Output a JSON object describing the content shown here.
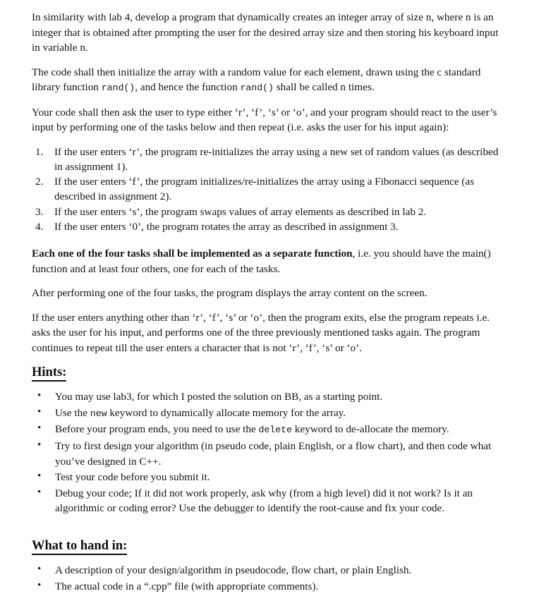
{
  "document": {
    "intro_paragraphs": [
      "In similarity with lab 4, develop a program that dynamically creates an integer array of size n, where n is an integer that is obtained after prompting the user for the desired array size and then storing his keyboard input in variable n.",
      "After performing one of the four tasks, the program displays the array content on the screen.",
      "If the user enters anything other than ‘r’, ‘f’, ‘s’ or ‘o’, then the program exits, else the program repeats i.e. asks the user for his input, and performs one of the three previously mentioned tasks again. The program continues to repeat till the user enters a character that is not ‘r’, ‘f’, ‘s’ or ‘o’."
    ],
    "rand_paragraph": {
      "part1": "The code shall then initialize the array with a random value for each element, drawn using the c standard library function ",
      "code1": "rand()",
      "part2": ", and hence the function ",
      "code2": "rand()",
      "part3": " shall be called n times."
    },
    "react_paragraph": "Your code shall then ask the user to type either ‘r’, ‘f’, ‘s’ or ‘o’, and your program should react to the user’s input by performing one of the tasks below and then repeat (i.e. asks the user for his input again):",
    "task_list": [
      "If the user enters ‘r’, the program re-initializes the array using a new set of random values (as described in assignment 1).",
      "If the user enters ‘f’, the program initializes/re-initializes the array using a Fibonacci sequence (as described in assignment 2).",
      "If the user enters ‘s’, the program swaps values of array elements as described in lab 2.",
      "If the user enters ‘0’, the program rotates the array as described in assignment 3."
    ],
    "separate_function_paragraph": {
      "bold_part": "Each one of the four tasks shall be implemented as a separate function",
      "rest": ", i.e. you should have the main() function and at least four others, one for each of the tasks."
    },
    "hints_section": {
      "heading": "Hints:",
      "items": [
        {
          "part1": "You may use lab3, for which I posted the solution on BB, as a starting point."
        },
        {
          "part1": "Use the ",
          "code": "new",
          "part2": " keyword to dynamically allocate memory for the array."
        },
        {
          "part1": "Before your program ends, you need to use the ",
          "code": "delete",
          "part2": " keyword to de-allocate the memory."
        },
        {
          "part1": "Try to first design your algorithm (in pseudo code, plain English, or a flow chart), and then code what you’ve designed in C++."
        },
        {
          "part1": "Test your code before you submit it."
        },
        {
          "part1": "Debug your code; If it did not work properly, ask why (from a high level) did it not work? Is it an algorithmic or coding error? Use the debugger to identify the root-cause and fix your code."
        }
      ]
    },
    "hand_in_section": {
      "heading": "What to hand in:",
      "items": [
        "A description of your design/algorithm in pseudocode, flow chart, or plain English.",
        "The actual code in a “.cpp” file (with appropriate comments)."
      ]
    }
  }
}
